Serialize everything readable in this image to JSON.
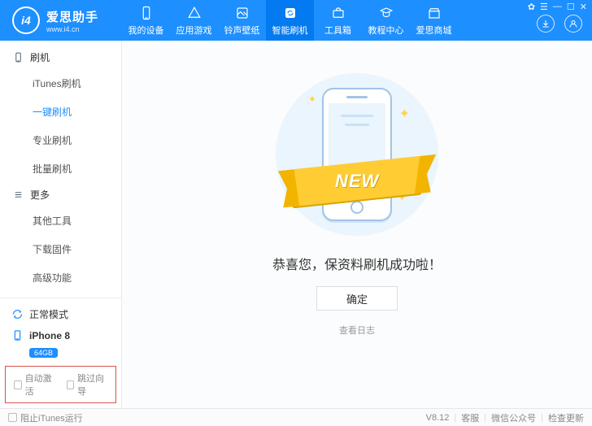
{
  "brand": {
    "logo_text": "i4",
    "title": "爱思助手",
    "url": "www.i4.cn"
  },
  "header_tabs": [
    {
      "label": "我的设备"
    },
    {
      "label": "应用游戏"
    },
    {
      "label": "铃声壁纸"
    },
    {
      "label": "智能刷机",
      "active": true
    },
    {
      "label": "工具箱"
    },
    {
      "label": "教程中心"
    },
    {
      "label": "爱思商城"
    }
  ],
  "sidebar": {
    "group1": {
      "header": "刷机"
    },
    "items1": [
      "iTunes刷机",
      "一键刷机",
      "专业刷机",
      "批量刷机"
    ],
    "active1": 1,
    "group2": {
      "header": "更多"
    },
    "items2": [
      "其他工具",
      "下载固件",
      "高级功能"
    ],
    "mode": {
      "label": "正常模式"
    },
    "device": {
      "name": "iPhone 8",
      "capacity": "64GB"
    },
    "checkboxes": {
      "auto_activate": "自动激活",
      "skip_guide": "跳过向导"
    }
  },
  "main": {
    "ribbon": "NEW",
    "success": "恭喜您，保资料刷机成功啦！",
    "ok": "确定",
    "view_log": "查看日志"
  },
  "footer": {
    "prevent_itunes": "阻止iTunes运行",
    "version": "V8.12",
    "support": "客服",
    "wechat": "微信公众号",
    "update": "检查更新"
  }
}
